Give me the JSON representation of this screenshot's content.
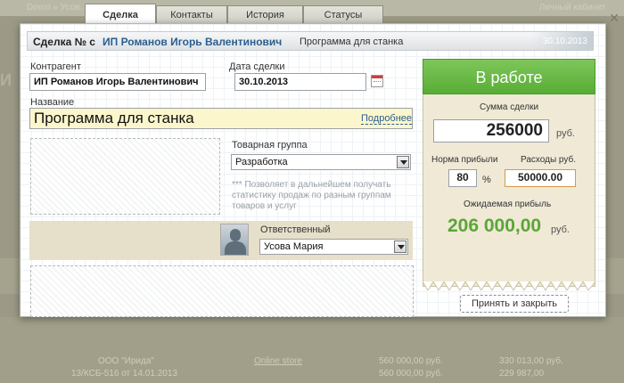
{
  "background": {
    "crumb": "Demo » Усов...",
    "user_link": "Личный кабинет",
    "rows": [
      {
        "col1": "",
        "col2": "ООО \"Ирида\"",
        "col3": "Online store",
        "col4": "560 000,00 руб.",
        "col5": "330 013,00 руб."
      },
      {
        "col1": "",
        "col2": "13/КСБ-516 от 14.01.2013",
        "col3": "",
        "col4": "560 000,00 руб.",
        "col5": "229 987,00"
      }
    ]
  },
  "tabs": [
    {
      "label": "Сделка",
      "active": true
    },
    {
      "label": "Контакты",
      "active": false
    },
    {
      "label": "История",
      "active": false
    },
    {
      "label": "Статусы",
      "active": false
    }
  ],
  "header": {
    "deal_label": "Сделка № с",
    "client": "ИП Романов Игорь Валентинович",
    "title": "Программа для станка",
    "date": "30.10.2013"
  },
  "form": {
    "counterparty_label": "Контрагент",
    "counterparty_value": "ИП Романов Игорь Валентинович",
    "date_label": "Дата сделки",
    "date_value": "30.10.2013",
    "name_label": "Название",
    "name_value": "Программа для станка",
    "more_link": "Подробнее",
    "product_group_label": "Товарная группа",
    "product_group_value": "Разработка",
    "hint": "*** Позволяет в дальнейшем получать статистику продаж по разным группам товаров и услуг",
    "responsible_label": "Ответственный",
    "responsible_value": "Усова Мария"
  },
  "status_panel": {
    "status_label": "В работе",
    "amount_label": "Сумма сделки",
    "amount_value": "256000",
    "currency": "руб.",
    "margin_label": "Норма прибыли",
    "margin_value": "80",
    "percent_sign": "%",
    "expenses_label": "Расходы руб.",
    "expenses_value": "50000.00",
    "expected_profit_label": "Ожидаемая прибыль",
    "expected_profit_value": "206 000,00",
    "accept_button": "Принять и закрыть"
  },
  "colors": {
    "status_green": "#5aad35",
    "link_blue": "#2a5e90",
    "highlight_yellow": "#fcf6cc"
  },
  "icons": {
    "close": "close-icon",
    "calendar": "calendar-icon",
    "avatar": "user-avatar-icon",
    "dropdown": "chevron-down-icon"
  }
}
